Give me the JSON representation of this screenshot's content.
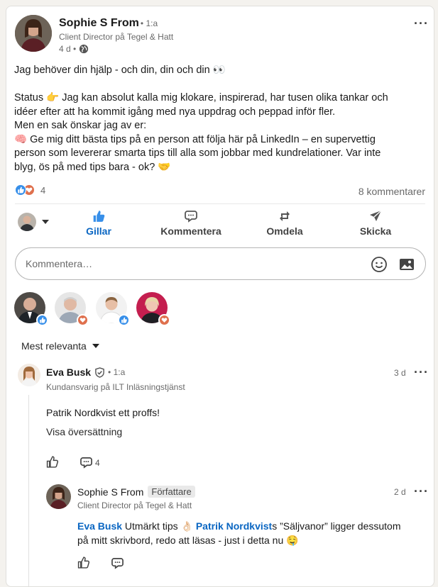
{
  "post": {
    "author": "Sophie S From",
    "degree": "• 1:a",
    "headline": "Client Director på Tegel & Hatt",
    "age": "4 d •",
    "lines": [
      "Jag behöver din hjälp - och din, din och din 👀",
      "",
      "Status 👉  Jag kan absolut kalla mig klokare, inspirerad, har tusen olika tankar och",
      "idéer efter att ha kommit igång med nya uppdrag och peppad inför fler.",
      "Men en sak önskar jag av er:",
      "🧠 Ge mig ditt bästa tips på en person att följa här på LinkedIn – en supervettig",
      "person som levererar smarta tips till alla som jobbar med kundrelationer. Var inte",
      "blyg, ös på med tips bara - ok? 🤝"
    ],
    "reaction_count": "4",
    "comment_count": "8 kommentarer"
  },
  "actions": {
    "like": "Gillar",
    "comment": "Kommentera",
    "repost": "Omdela",
    "send": "Skicka"
  },
  "comment_box": {
    "placeholder": "Kommentera…"
  },
  "sort": {
    "label": "Mest relevanta"
  },
  "comments": [
    {
      "author": "Eva Busk",
      "degree": "• 1:a",
      "headline": "Kundansvarig på ILT Inläsningstjänst",
      "age": "3 d",
      "mention": "Patrik Nordkvist",
      "text": "  ett proffs!",
      "translate": "Visa översättning",
      "reply_count": "4"
    }
  ],
  "reply": {
    "author": "Sophie S From",
    "author_badge": "Författare",
    "headline": "Client Director på Tegel & Hatt",
    "age": "2 d",
    "mention1": "Eva Busk",
    "text1": " Utmärkt tips 👌🏻 ",
    "mention2": "Patrik Nordkvist",
    "text2": "s ”Säljvanor” ligger dessutom",
    "line2": "på mitt skrivbord, redo att läsas - just i detta nu 🤤"
  },
  "colors": {
    "link": "#0a66c2",
    "like_blue": "#378fe9",
    "love_red": "#df704d"
  }
}
